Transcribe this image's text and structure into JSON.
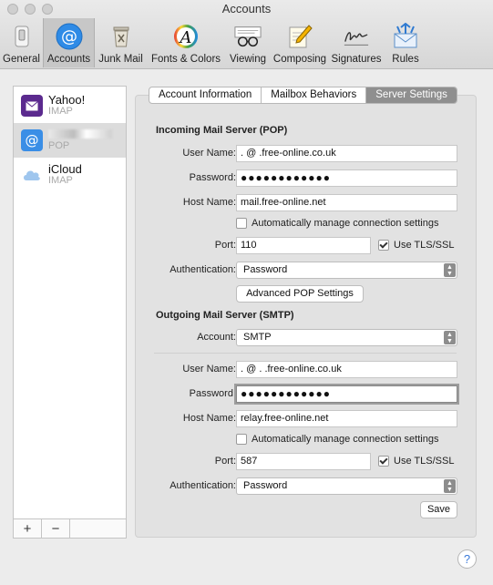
{
  "window": {
    "title": "Accounts"
  },
  "toolbar": {
    "items": [
      {
        "label": "General",
        "icon": "general-switch-icon"
      },
      {
        "label": "Accounts",
        "icon": "at-sign-icon"
      },
      {
        "label": "Junk Mail",
        "icon": "trash-can-icon"
      },
      {
        "label": "Fonts & Colors",
        "icon": "font-colors-icon"
      },
      {
        "label": "Viewing",
        "icon": "glasses-icon"
      },
      {
        "label": "Composing",
        "icon": "pencil-paper-icon"
      },
      {
        "label": "Signatures",
        "icon": "signature-icon"
      },
      {
        "label": "Rules",
        "icon": "rules-envelope-icon"
      }
    ],
    "selected": "Accounts"
  },
  "sidebar": {
    "accounts": [
      {
        "name": "Yahoo!",
        "type": "IMAP",
        "icon": "yahoo-envelope-icon",
        "color": "#5b2a8e"
      },
      {
        "name": "",
        "type": "POP",
        "icon": "at-sign-icon",
        "color": "#3a8ee6"
      },
      {
        "name": "iCloud",
        "type": "IMAP",
        "icon": "cloud-icon",
        "color": "#9fc6ee"
      }
    ],
    "add_label": "+",
    "remove_label": "−"
  },
  "tabs": [
    {
      "label": "Account Information"
    },
    {
      "label": "Mailbox Behaviors"
    },
    {
      "label": "Server Settings"
    }
  ],
  "incoming": {
    "title": "Incoming Mail Server (POP)",
    "user_name_label": "User Name:",
    "user_name_value": "  .  @          .free-online.co.uk",
    "password_label": "Password:",
    "password_value": "●●●●●●●●●●●●",
    "host_name_label": "Host Name:",
    "host_name_value": "mail.free-online.net",
    "auto_manage_label": "Automatically manage connection settings",
    "port_label": "Port:",
    "port_value": "110",
    "tls_label": "Use TLS/SSL",
    "auth_label": "Authentication:",
    "auth_value": "Password",
    "advanced_button": "Advanced POP Settings"
  },
  "outgoing": {
    "title": "Outgoing Mail Server (SMTP)",
    "account_label": "Account:",
    "account_value": "SMTP",
    "user_name_label": "User Name:",
    "user_name_value": "  .  @          . .free-online.co.uk",
    "password_label": "Password:",
    "password_value": "●●●●●●●●●●●●",
    "host_name_label": "Host Name:",
    "host_name_value": "relay.free-online.net",
    "auto_manage_label": "Automatically manage connection settings",
    "port_label": "Port:",
    "port_value": "587",
    "tls_label": "Use TLS/SSL",
    "auth_label": "Authentication:",
    "auth_value": "Password"
  },
  "save_button": "Save",
  "help_label": "?"
}
